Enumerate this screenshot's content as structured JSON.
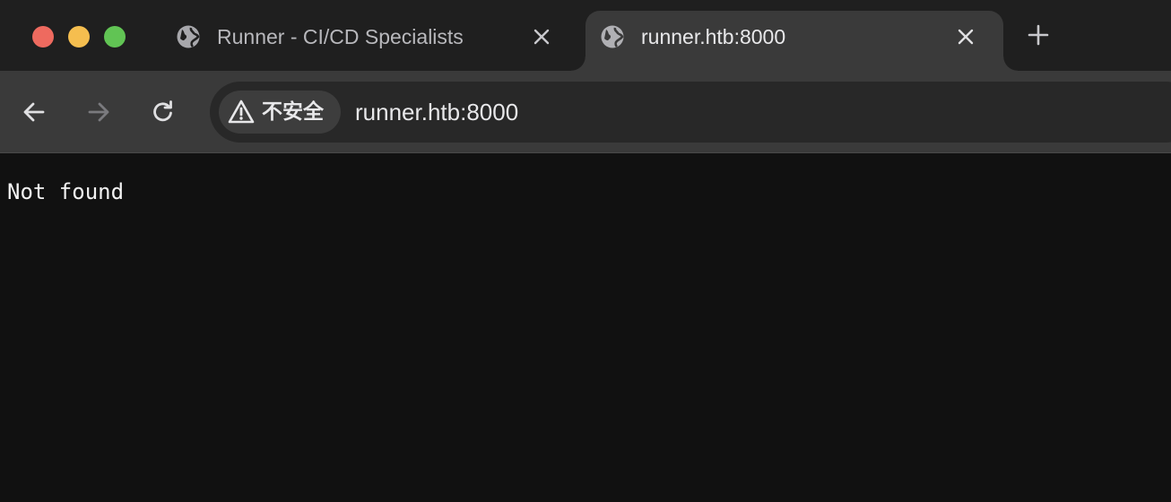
{
  "window": {
    "controls": [
      "close",
      "minimize",
      "maximize"
    ],
    "colors": {
      "close": "#ee6a5f",
      "minimize": "#f5be4f",
      "maximize": "#61c454"
    }
  },
  "tabs": [
    {
      "title": "Runner - CI/CD Specialists",
      "icon": "globe-icon",
      "active": false
    },
    {
      "title": "runner.htb:8000",
      "icon": "globe-icon",
      "active": true
    }
  ],
  "new_tab_icon": "plus-icon",
  "toolbar": {
    "back_icon": "arrow-left-icon",
    "forward_icon": "arrow-right-icon",
    "reload_icon": "reload-icon",
    "security_label": "不安全",
    "security_icon": "warning-triangle-icon",
    "url": "runner.htb:8000"
  },
  "page": {
    "text": "Not found"
  }
}
